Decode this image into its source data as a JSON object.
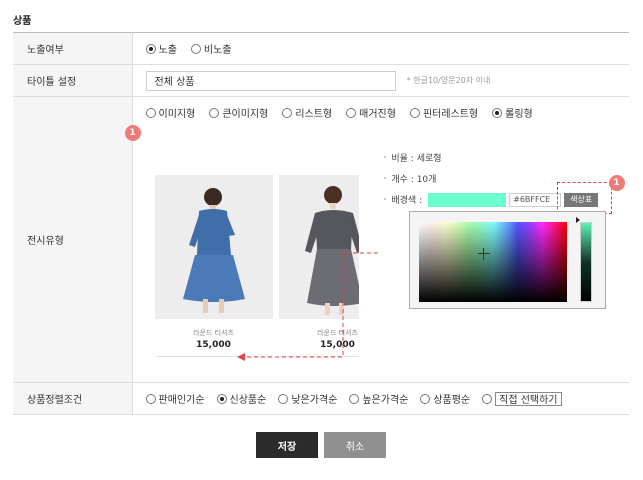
{
  "section_title": "상품",
  "rows": {
    "visibility": {
      "label": "노출여부",
      "options": [
        "노출",
        "비노출"
      ],
      "selected": 0
    },
    "title": {
      "label": "타이틀 설정",
      "value": "전체 상품",
      "hint": "* 한글10/영문20자 이내"
    },
    "display_type": {
      "label": "전시유형",
      "options": [
        "이미지형",
        "큰이미지형",
        "리스트형",
        "매거진형",
        "핀터레스트형",
        "롤링형"
      ],
      "selected": 5,
      "badge": "1",
      "info": {
        "ratio": "비율 : 세로형",
        "count": "개수 : 10개",
        "bgcolor_label": "배경색 :",
        "bgcolor_hex": "#6BFFCE",
        "bgcolor_swatch": "#6bffce",
        "color_button": "색상표"
      },
      "products": [
        {
          "name": "라운드 티셔츠",
          "price": "15,000"
        },
        {
          "name": "라운드 티셔츠",
          "price": "15,000"
        }
      ]
    },
    "sort": {
      "label": "상품정렬조건",
      "options": [
        "판매인기순",
        "신상품순",
        "낮은가격순",
        "높은가격순",
        "상품평순",
        "직접 선택하기"
      ],
      "selected": 1
    }
  },
  "buttons": {
    "save": "저장",
    "cancel": "취소"
  },
  "colors": {
    "annotation": "#e04444",
    "badge": "#ef7a78",
    "save_button": "#2b2b2b",
    "cancel_button": "#909090"
  }
}
